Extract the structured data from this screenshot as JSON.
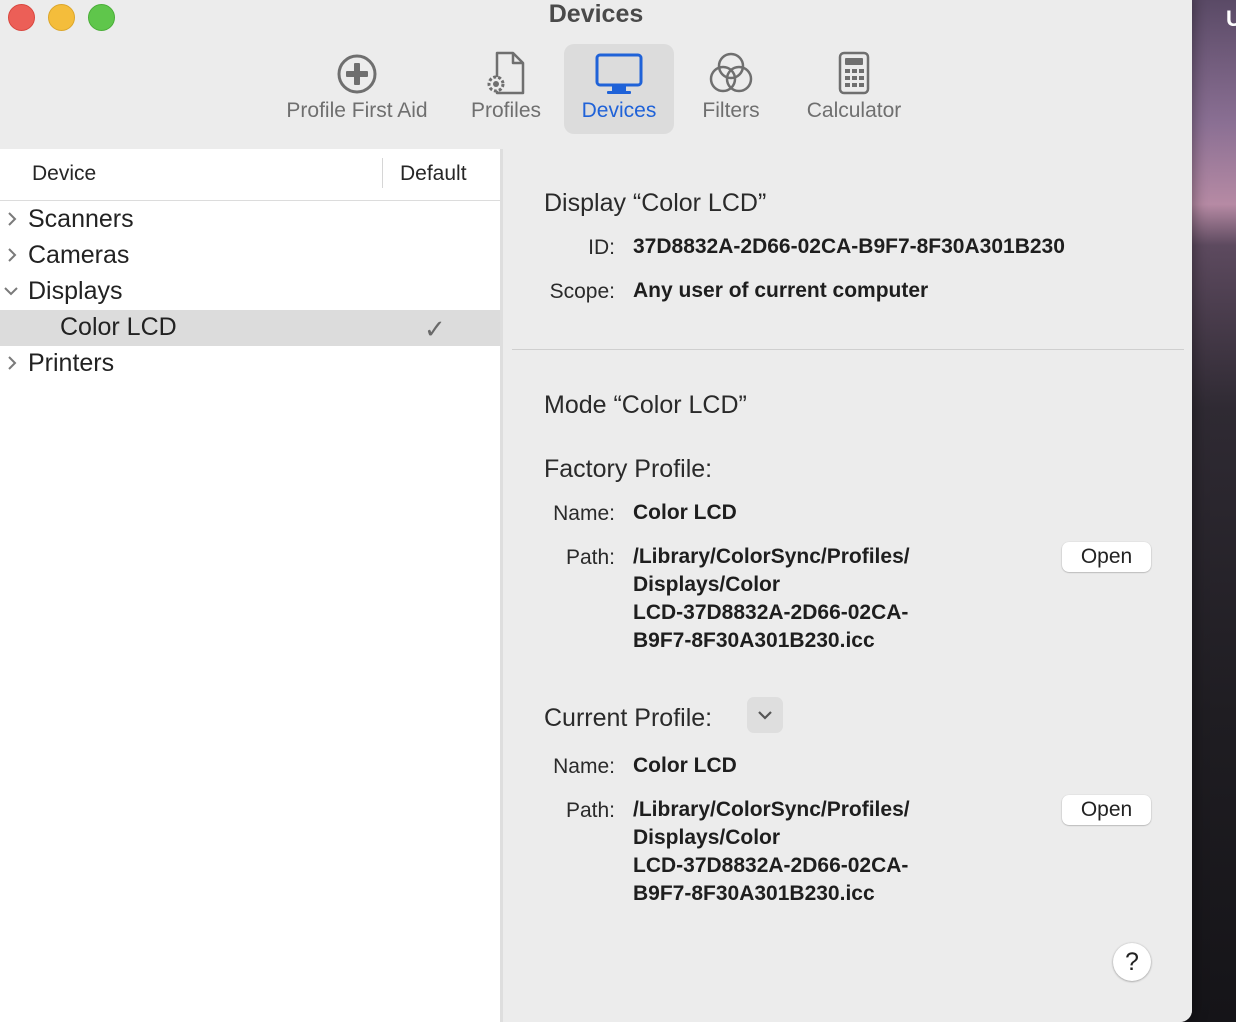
{
  "window": {
    "title": "Devices"
  },
  "wallpaper_peek_text": "U",
  "toolbar": {
    "items": [
      {
        "label": "Profile First Aid",
        "icon": "first-aid-icon"
      },
      {
        "label": "Profiles",
        "icon": "profiles-icon"
      },
      {
        "label": "Devices",
        "icon": "display-icon",
        "selected": true
      },
      {
        "label": "Filters",
        "icon": "filters-icon"
      },
      {
        "label": "Calculator",
        "icon": "calculator-icon"
      }
    ]
  },
  "sidebar": {
    "columns": {
      "device": "Device",
      "default": "Default"
    },
    "items": [
      {
        "label": "Scanners",
        "expanded": false
      },
      {
        "label": "Cameras",
        "expanded": false
      },
      {
        "label": "Displays",
        "expanded": true
      },
      {
        "label": "Color LCD",
        "child": true,
        "selected": true,
        "default": "✓"
      },
      {
        "label": "Printers",
        "expanded": false
      }
    ]
  },
  "detail": {
    "display_heading": "Display “Color LCD”",
    "id_label": "ID:",
    "id_value": "37D8832A-2D66-02CA-B9F7-8F30A301B230",
    "scope_label": "Scope:",
    "scope_value": "Any user of current computer",
    "mode_heading": "Mode “Color LCD”",
    "factory": {
      "heading": "Factory Profile:",
      "name_label": "Name:",
      "name_value": "Color LCD",
      "path_label": "Path:",
      "path_lines": [
        "/Library/ColorSync/Profiles/",
        "Displays/Color",
        "LCD-37D8832A-2D66-02CA-",
        "B9F7-8F30A301B230.icc"
      ],
      "open_label": "Open"
    },
    "current": {
      "heading": "Current Profile:",
      "name_label": "Name:",
      "name_value": "Color LCD",
      "path_label": "Path:",
      "path_lines": [
        "/Library/ColorSync/Profiles/",
        "Displays/Color",
        "LCD-37D8832A-2D66-02CA-",
        "B9F7-8F30A301B230.icc"
      ],
      "open_label": "Open"
    },
    "help_label": "?"
  },
  "colors": {
    "accent": "#1f62d8",
    "selection": "#dcdcdc"
  }
}
